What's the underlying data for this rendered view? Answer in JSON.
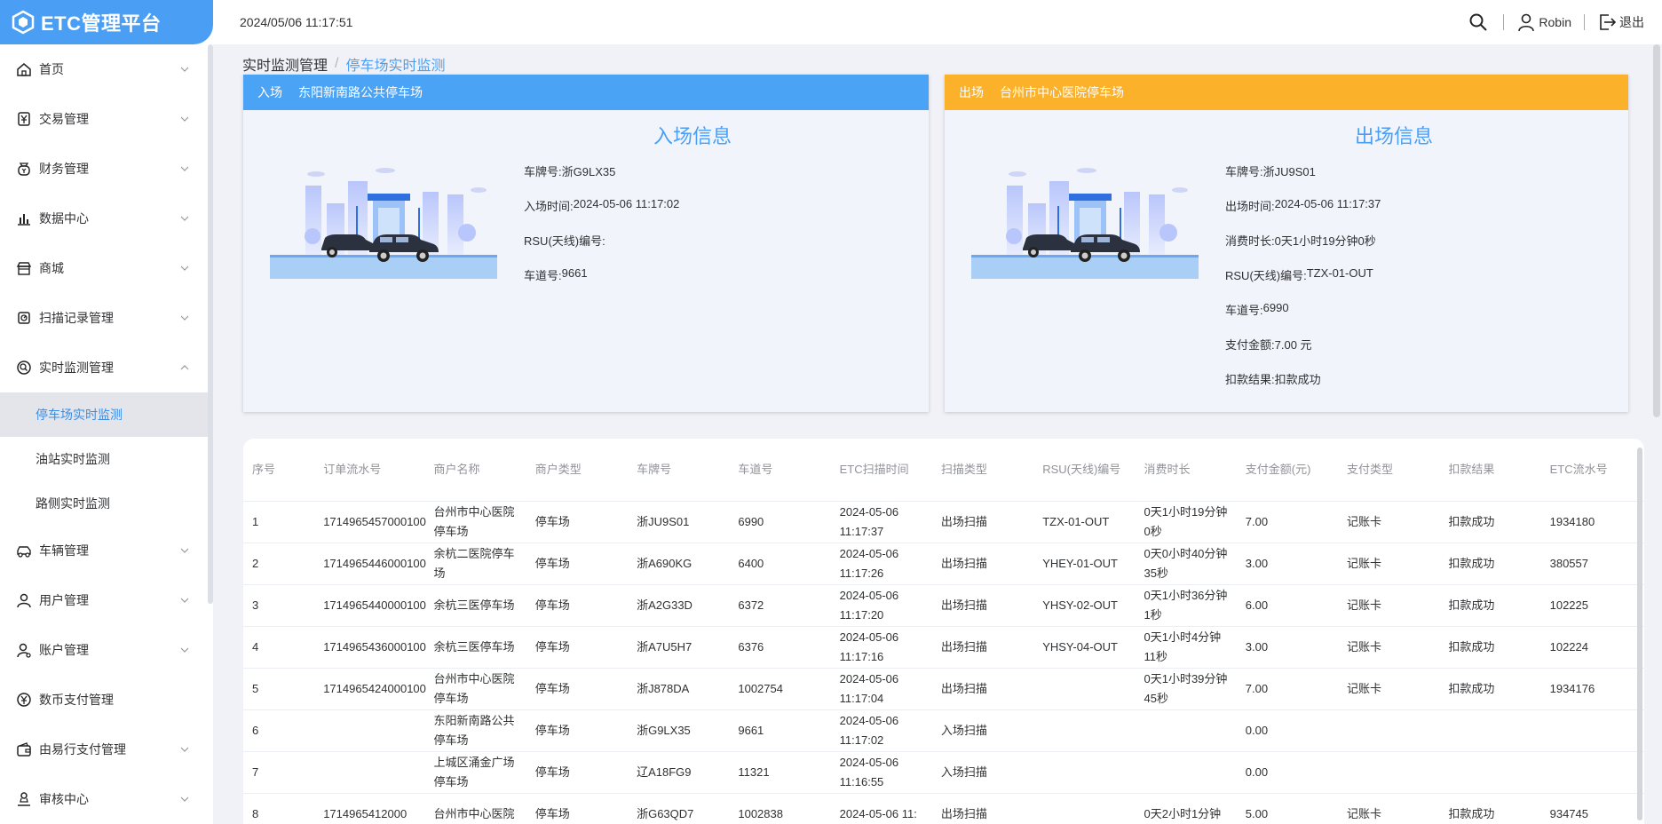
{
  "app": {
    "title": "ETC管理平台"
  },
  "header": {
    "datetime": "2024/05/06 11:17:51",
    "user": "Robin",
    "logout": "退出"
  },
  "sidebar": {
    "items": [
      {
        "label": "首页",
        "icon": "home-icon",
        "expanded": false
      },
      {
        "label": "交易管理",
        "icon": "yen-doc-icon",
        "expanded": false
      },
      {
        "label": "财务管理",
        "icon": "money-bag-icon",
        "expanded": false
      },
      {
        "label": "数据中心",
        "icon": "bar-chart-icon",
        "expanded": false
      },
      {
        "label": "商城",
        "icon": "store-icon",
        "expanded": false
      },
      {
        "label": "扫描记录管理",
        "icon": "scan-icon",
        "expanded": false
      },
      {
        "label": "实时监测管理",
        "icon": "monitor-icon",
        "expanded": true
      },
      {
        "label": "车辆管理",
        "icon": "car-icon",
        "expanded": false
      },
      {
        "label": "用户管理",
        "icon": "user-icon",
        "expanded": false
      },
      {
        "label": "账户管理",
        "icon": "account-icon",
        "expanded": false
      },
      {
        "label": "数币支付管理",
        "icon": "coin-icon",
        "expanded": false
      },
      {
        "label": "由易行支付管理",
        "icon": "wallet-icon",
        "expanded": false
      },
      {
        "label": "审核中心",
        "icon": "audit-icon",
        "expanded": false
      }
    ],
    "subitems": [
      {
        "label": "停车场实时监测",
        "active": true
      },
      {
        "label": "油站实时监测",
        "active": false
      },
      {
        "label": "路侧实时监测",
        "active": false
      }
    ]
  },
  "breadcrumb": {
    "level1": "实时监测管理",
    "separator": "/",
    "level2": "停车场实时监测"
  },
  "entry": {
    "type": "入场",
    "lot": "东阳新南路公共停车场",
    "title": "入场信息",
    "rows": [
      {
        "label": "车牌号:",
        "value": "浙G9LX35"
      },
      {
        "label": "入场时间:",
        "value": "2024-05-06 11:17:02"
      },
      {
        "label": "RSU(天线)编号:",
        "value": ""
      },
      {
        "label": "车道号:",
        "value": "9661"
      }
    ]
  },
  "exit": {
    "type": "出场",
    "lot": "台州市中心医院停车场",
    "title": "出场信息",
    "rows": [
      {
        "label": "车牌号:",
        "value": "浙JU9S01"
      },
      {
        "label": "出场时间:",
        "value": "2024-05-06 11:17:37"
      },
      {
        "label": "消费时长:",
        "value": "0天1小时19分钟0秒"
      },
      {
        "label": "RSU(天线)编号:",
        "value": "TZX-01-OUT"
      },
      {
        "label": "车道号:",
        "value": "6990"
      },
      {
        "label": "支付金额:",
        "value": "7.00 元"
      },
      {
        "label": "扣款结果:",
        "value": "扣款成功"
      }
    ]
  },
  "table": {
    "columns": [
      "序号",
      "订单流水号",
      "商户名称",
      "商户类型",
      "车牌号",
      "车道号",
      "ETC扫描时间",
      "扫描类型",
      "RSU(天线)编号",
      "消费时长",
      "支付金额(元)",
      "支付类型",
      "扣款结果",
      "ETC流水号"
    ],
    "rows": [
      [
        "1",
        "1714965457000100",
        "台州市中心医院停车场",
        "停车场",
        "浙JU9S01",
        "6990",
        "2024-05-06 11:17:37",
        "出场扫描",
        "TZX-01-OUT",
        "0天1小时19分钟0秒",
        "7.00",
        "记账卡",
        "扣款成功",
        "1934180"
      ],
      [
        "2",
        "1714965446000100",
        "余杭二医院停车场",
        "停车场",
        "浙A690KG",
        "6400",
        "2024-05-06 11:17:26",
        "出场扫描",
        "YHEY-01-OUT",
        "0天0小时40分钟35秒",
        "3.00",
        "记账卡",
        "扣款成功",
        "380557"
      ],
      [
        "3",
        "1714965440000100",
        "余杭三医停车场",
        "停车场",
        "浙A2G33D",
        "6372",
        "2024-05-06 11:17:20",
        "出场扫描",
        "YHSY-02-OUT",
        "0天1小时36分钟1秒",
        "6.00",
        "记账卡",
        "扣款成功",
        "102225"
      ],
      [
        "4",
        "1714965436000100",
        "余杭三医停车场",
        "停车场",
        "浙A7U5H7",
        "6376",
        "2024-05-06 11:17:16",
        "出场扫描",
        "YHSY-04-OUT",
        "0天1小时4分钟11秒",
        "3.00",
        "记账卡",
        "扣款成功",
        "102224"
      ],
      [
        "5",
        "1714965424000100",
        "台州市中心医院停车场",
        "停车场",
        "浙J878DA",
        "1002754",
        "2024-05-06 11:17:04",
        "出场扫描",
        "",
        "0天1小时39分钟45秒",
        "7.00",
        "记账卡",
        "扣款成功",
        "1934176"
      ],
      [
        "6",
        "",
        "东阳新南路公共停车场",
        "停车场",
        "浙G9LX35",
        "9661",
        "2024-05-06 11:17:02",
        "入场扫描",
        "",
        "",
        "0.00",
        "",
        "",
        ""
      ],
      [
        "7",
        "",
        "上城区涌金广场停车场",
        "停车场",
        "辽A18FG9",
        "11321",
        "2024-05-06 11:16:55",
        "入场扫描",
        "",
        "",
        "0.00",
        "",
        "",
        ""
      ],
      [
        "8",
        "1714965412000",
        "台州市中心医院",
        "停车场",
        "浙G63QD7",
        "1002838",
        "2024-05-06 11:",
        "出场扫描",
        "",
        "0天2小时1分钟",
        "5.00",
        "记账卡",
        "扣款成功",
        "934745"
      ]
    ]
  },
  "colors": {
    "primary": "#4a9ff5",
    "exit_header": "#fbb12a",
    "entry_header": "#4aa3f5"
  }
}
